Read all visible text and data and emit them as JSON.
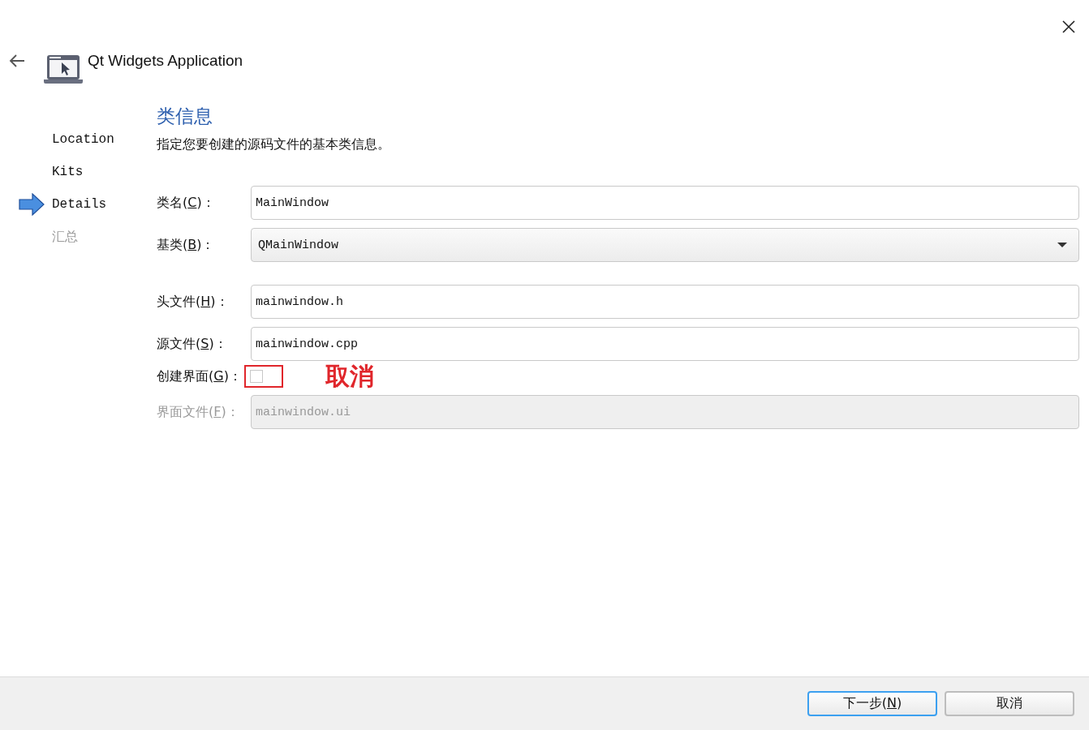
{
  "window": {
    "title": "Qt Widgets Application"
  },
  "sidebar": {
    "items": [
      {
        "label": "Location",
        "selected": false,
        "disabled": false
      },
      {
        "label": "Kits",
        "selected": false,
        "disabled": false
      },
      {
        "label": "Details",
        "selected": true,
        "disabled": false
      },
      {
        "label": "汇总",
        "selected": false,
        "disabled": true
      }
    ]
  },
  "page": {
    "heading": "类信息",
    "description": "指定您要创建的源码文件的基本类信息。"
  },
  "form": [
    {
      "kind": "text",
      "before": "类名(",
      "mnemonic": "C",
      "after": ")：",
      "value": "MainWindow",
      "disabled": false
    },
    {
      "kind": "combo",
      "before": "基类(",
      "mnemonic": "B",
      "after": ")：",
      "value": "QMainWindow",
      "disabled": false
    },
    {
      "kind": "text",
      "before": "头文件(",
      "mnemonic": "H",
      "after": ")：",
      "value": "mainwindow.h",
      "disabled": false
    },
    {
      "kind": "text",
      "before": "源文件(",
      "mnemonic": "S",
      "after": ")：",
      "value": "mainwindow.cpp",
      "disabled": false
    },
    {
      "kind": "check",
      "before": "创建界面(",
      "mnemonic": "G",
      "after": ")：",
      "checked": false,
      "annotation": "取消",
      "disabled": false
    },
    {
      "kind": "text",
      "before": "界面文件(",
      "mnemonic": "F",
      "after": ")：",
      "value": "mainwindow.ui",
      "disabled": true
    }
  ],
  "buttons": [
    {
      "label_before": "下一步(",
      "mnemonic": "N",
      "label_after": ")",
      "default": true
    },
    {
      "label_before": "取消",
      "default": false
    }
  ]
}
